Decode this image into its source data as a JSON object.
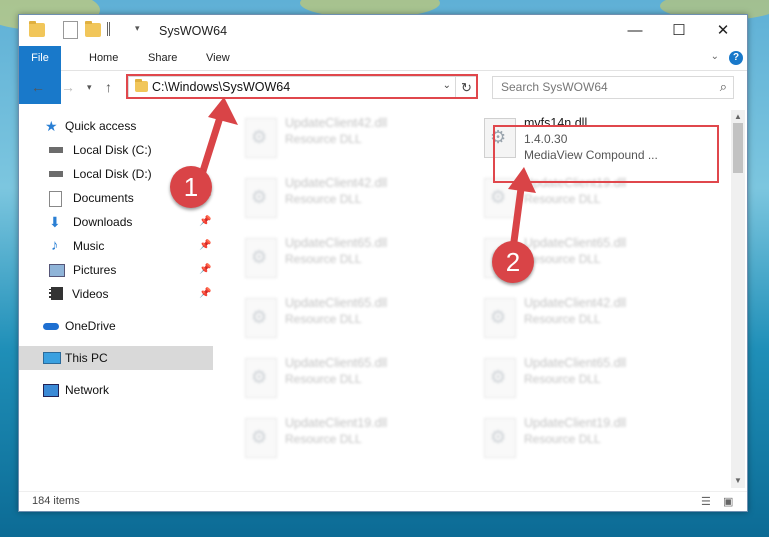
{
  "window": {
    "title": "SysWOW64",
    "controls": {
      "minimize": "—",
      "maximize": "☐",
      "close": "✕"
    }
  },
  "ribbon": {
    "tabs": [
      "File",
      "Home",
      "Share",
      "View"
    ],
    "help": "?"
  },
  "address": {
    "path": "C:\\Windows\\SysWOW64",
    "search_placeholder": "Search SysWOW64"
  },
  "sidebar": {
    "items": [
      {
        "label": "Quick access",
        "icon": "star-icon"
      },
      {
        "label": "Local Disk (C:)",
        "icon": "drive-icon"
      },
      {
        "label": "Local Disk (D:)",
        "icon": "drive-icon"
      },
      {
        "label": "Documents",
        "icon": "documents-icon"
      },
      {
        "label": "Downloads",
        "icon": "download-icon"
      },
      {
        "label": "Music",
        "icon": "music-icon"
      },
      {
        "label": "Pictures",
        "icon": "pictures-icon"
      },
      {
        "label": "Videos",
        "icon": "videos-icon"
      },
      {
        "label": "OneDrive",
        "icon": "onedrive-icon"
      },
      {
        "label": "This PC",
        "icon": "computer-icon"
      },
      {
        "label": "Network",
        "icon": "network-icon"
      }
    ]
  },
  "files": {
    "selected": {
      "name": "mvfs14n.dll",
      "version": "1.4.0.30",
      "description": "MediaView Compound ..."
    },
    "left_column": [
      {
        "name": "UpdateClient42.dll",
        "type": "Resource DLL"
      },
      {
        "name": "UpdateClient42.dll",
        "type": "Resource DLL"
      },
      {
        "name": "UpdateClient65.dll",
        "type": "Resource DLL"
      },
      {
        "name": "UpdateClient65.dll",
        "type": "Resource DLL"
      },
      {
        "name": "UpdateClient65.dll",
        "type": "Resource DLL"
      },
      {
        "name": "UpdateClient19.dll",
        "type": "Resource DLL"
      }
    ],
    "right_column": [
      {
        "name": "UpdateClient19.dll",
        "type": "Resource DLL"
      },
      {
        "name": "UpdateClient65.dll",
        "type": "Resource DLL"
      },
      {
        "name": "UpdateClient42.dll",
        "type": "Resource DLL"
      },
      {
        "name": "UpdateClient65.dll",
        "type": "Resource DLL"
      },
      {
        "name": "UpdateClient19.dll",
        "type": "Resource DLL"
      }
    ]
  },
  "status": {
    "item_count": "184 items"
  },
  "annotations": {
    "step1": "1",
    "step2": "2"
  },
  "colors": {
    "highlight": "#e0474c",
    "accent": "#1979ca"
  }
}
